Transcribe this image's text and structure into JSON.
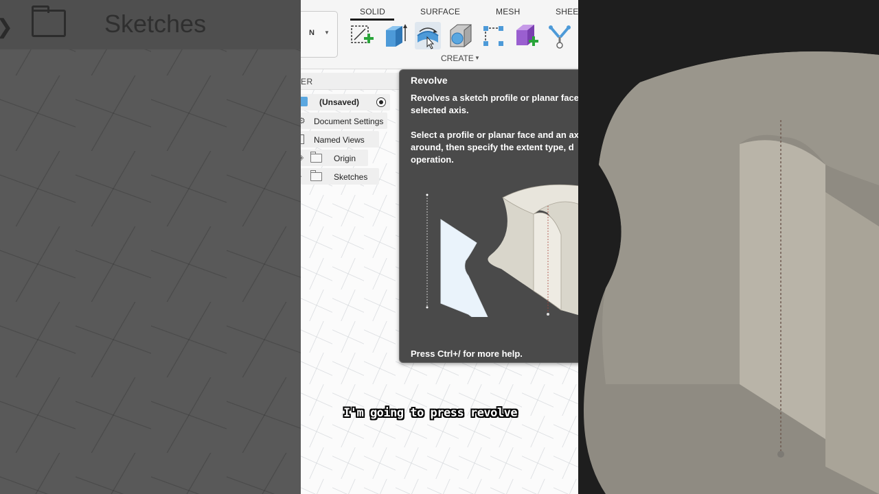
{
  "background_left": {
    "label": "Sketches"
  },
  "toolbar": {
    "workspace_label": "N",
    "tabs": [
      {
        "label": "SOLID",
        "active": true
      },
      {
        "label": "SURFACE"
      },
      {
        "label": "MESH"
      },
      {
        "label": "SHEET"
      }
    ],
    "tools": [
      "create-sketch-icon",
      "extrude-icon",
      "revolve-icon",
      "sweep-icon",
      "pattern-icon",
      "new-component-icon",
      "joint-icon"
    ],
    "create_label": "CREATE"
  },
  "browser": {
    "title": "ER",
    "items": [
      {
        "label": "(Unsaved)"
      },
      {
        "label": "Document Settings"
      },
      {
        "label": "Named Views"
      },
      {
        "label": "Origin"
      },
      {
        "label": "Sketches"
      }
    ]
  },
  "tooltip": {
    "title": "Revolve",
    "paragraph1": "Revolves a sketch profile or planar face\nselected axis.",
    "paragraph2": "Select a profile or planar face and an ax\naround, then specify the extent type, d\noperation.",
    "footer": "Press Ctrl+/ for more help."
  },
  "caption": "I'm going to press revolve",
  "colors": {
    "accent": "#1a1a1a",
    "tooltip_bg": "#4a4a4a",
    "canvas_grid": "#d6d9dd"
  }
}
